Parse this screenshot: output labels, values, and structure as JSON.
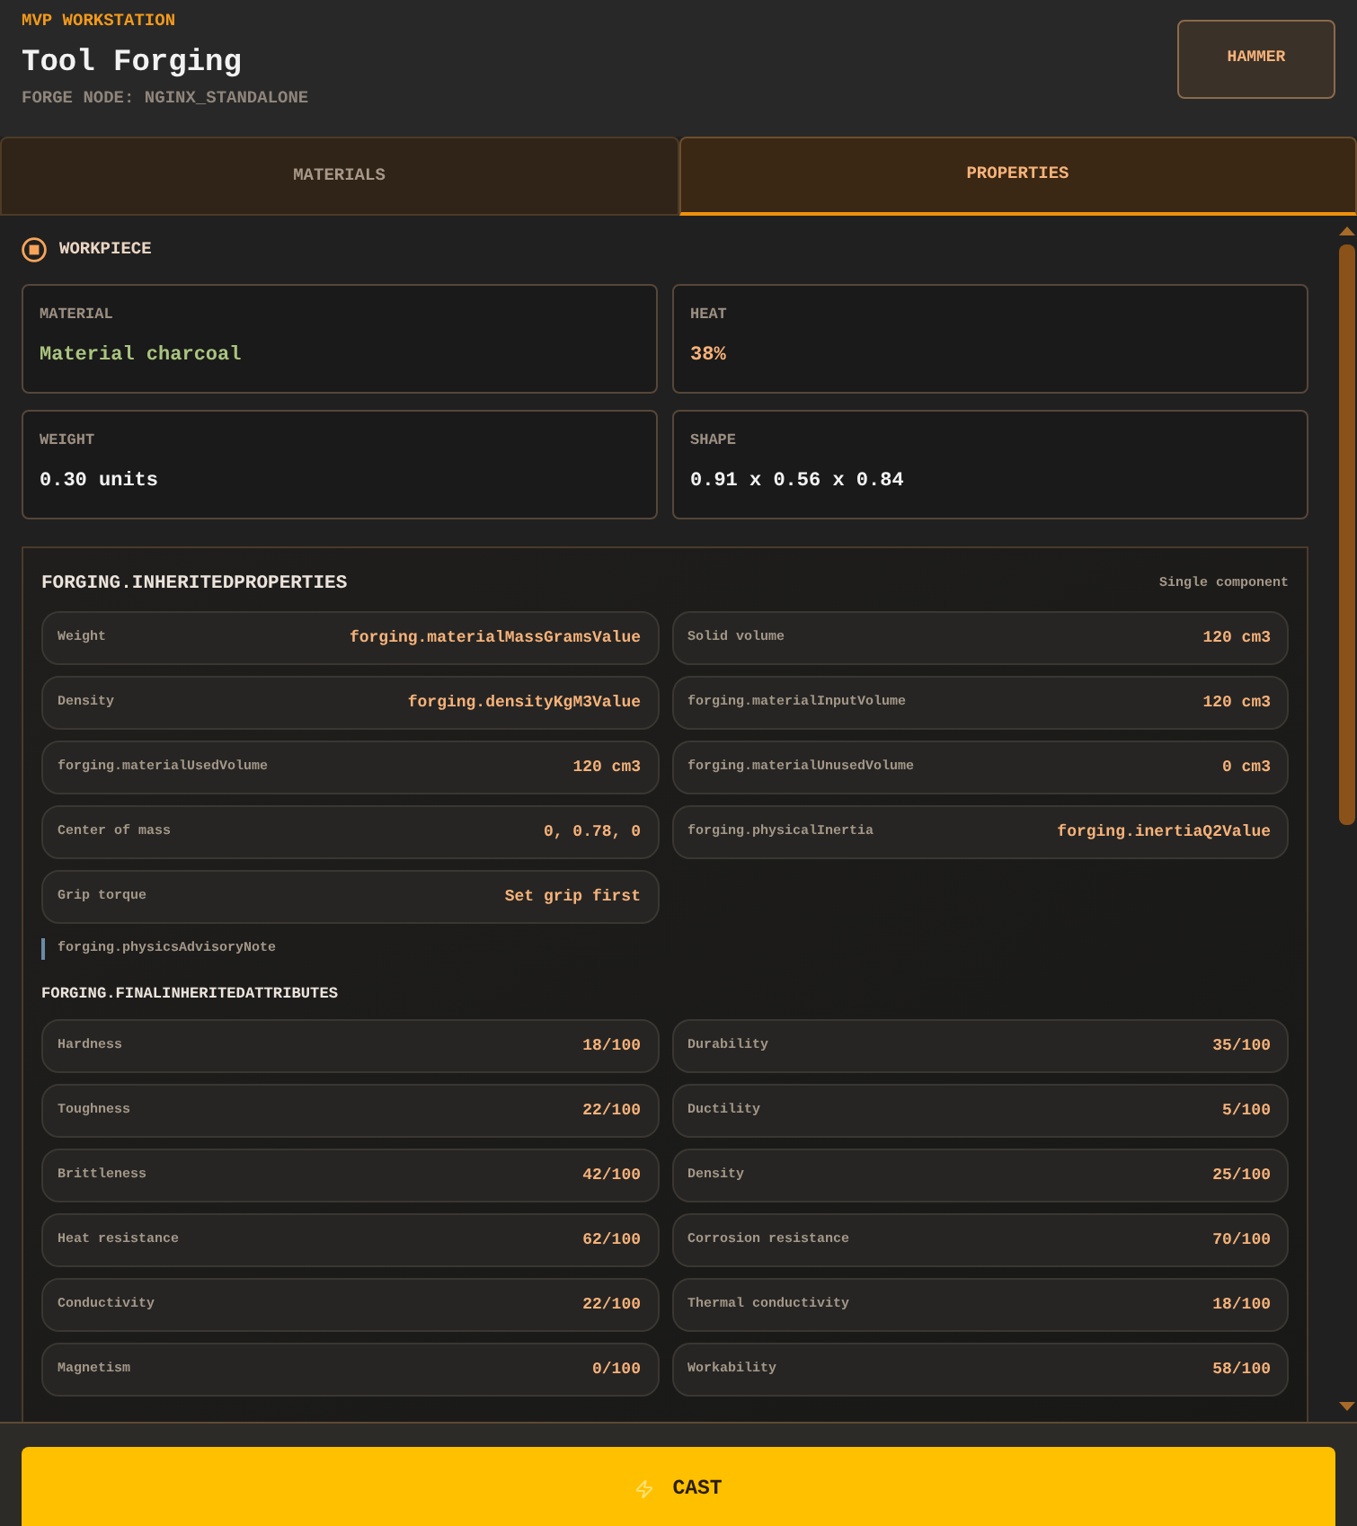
{
  "header": {
    "eyebrow": "MVP WORKSTATION",
    "title": "Tool Forging",
    "subtitle": "FORGE NODE: NGINX_STANDALONE",
    "action_button": "HAMMER"
  },
  "tabs": [
    {
      "label": "MATERIALS",
      "selected": false
    },
    {
      "label": "PROPERTIES",
      "selected": true
    }
  ],
  "workpiece": {
    "title": "WORKPIECE",
    "fields": [
      {
        "label": "MATERIAL",
        "value": "Material charcoal",
        "color": "#a9c47f"
      },
      {
        "label": "HEAT",
        "value": "38%",
        "color": "#f6b27a"
      },
      {
        "label": "WEIGHT",
        "value": "0.30 units",
        "color": "#f2f2f2"
      },
      {
        "label": "SHAPE",
        "value": "0.91 x 0.56 x 0.84",
        "color": "#f2f2f2"
      }
    ]
  },
  "inherited_properties": {
    "title": "FORGING.INHERITEDPROPERTIES",
    "badge": "Single component",
    "rows": [
      {
        "label": "Weight",
        "value": "forging.materialMassGramsValue"
      },
      {
        "label": "Solid volume",
        "value": "120 cm3"
      },
      {
        "label": "Density",
        "value": "forging.densityKgM3Value"
      },
      {
        "label": "forging.materialInputVolume",
        "value": "120 cm3"
      },
      {
        "label": "forging.materialUsedVolume",
        "value": "120 cm3"
      },
      {
        "label": "forging.materialUnusedVolume",
        "value": "0 cm3"
      },
      {
        "label": "Center of mass",
        "value": "0, 0.78, 0"
      },
      {
        "label": "forging.physicalInertia",
        "value": "forging.inertiaQ2Value"
      },
      {
        "label": "Grip torque",
        "value": "Set grip first"
      }
    ],
    "note": "forging.physicsAdvisoryNote"
  },
  "final_attributes": {
    "title": "FORGING.FINALINHERITEDATTRIBUTES",
    "rows": [
      {
        "label": "Hardness",
        "value": "18/100"
      },
      {
        "label": "Durability",
        "value": "35/100"
      },
      {
        "label": "Toughness",
        "value": "22/100"
      },
      {
        "label": "Ductility",
        "value": "5/100"
      },
      {
        "label": "Brittleness",
        "value": "42/100"
      },
      {
        "label": "Density",
        "value": "25/100"
      },
      {
        "label": "Heat resistance",
        "value": "62/100"
      },
      {
        "label": "Corrosion resistance",
        "value": "70/100"
      },
      {
        "label": "Conductivity",
        "value": "22/100"
      },
      {
        "label": "Thermal conductivity",
        "value": "18/100"
      },
      {
        "label": "Magnetism",
        "value": "0/100"
      },
      {
        "label": "Workability",
        "value": "58/100"
      }
    ]
  },
  "footer": {
    "button": "CAST"
  }
}
